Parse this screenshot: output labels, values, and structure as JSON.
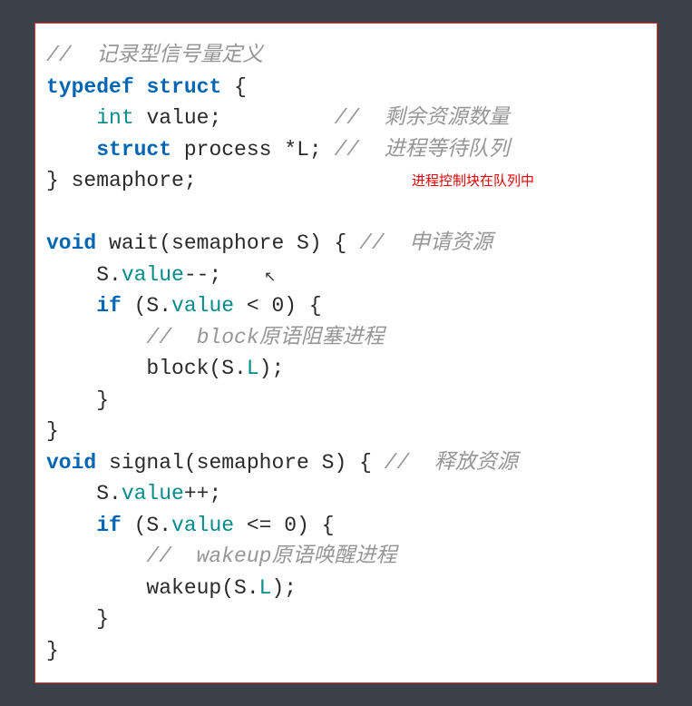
{
  "code": {
    "line1_comment": "//  记录型信号量定义",
    "line2_typedef": "typedef",
    "line2_struct": "struct",
    "line2_brace": " {",
    "line3_indent": "    ",
    "line3_type": "int",
    "line3_var": " value;         ",
    "line3_comment": "//  剩余资源数量",
    "line4_indent": "    ",
    "line4_struct": "struct",
    "line4_var": " process *L; ",
    "line4_comment": "//  进程等待队列",
    "line5": "} semaphore;",
    "line6": "",
    "line7_void": "void",
    "line7_func": " wait(semaphore S) { ",
    "line7_comment": "//  申请资源",
    "line8_indent": "    S.",
    "line8_member": "value",
    "line8_op": "--;",
    "line9_indent": "    ",
    "line9_if": "if",
    "line9_cond1": " (S.",
    "line9_member": "value",
    "line9_cond2": " < ",
    "line9_num": "0",
    "line9_cond3": ") {",
    "line10_indent": "        ",
    "line10_comment": "//  block原语阻塞进程",
    "line11_indent": "        block(S.",
    "line11_member": "L",
    "line11_end": ");",
    "line12": "    }",
    "line13": "}",
    "line14_void": "void",
    "line14_func": " signal(semaphore S) { ",
    "line14_comment": "//  释放资源",
    "line15_indent": "    S.",
    "line15_member": "value",
    "line15_op": "++;",
    "line16_indent": "    ",
    "line16_if": "if",
    "line16_cond1": " (S.",
    "line16_member": "value",
    "line16_cond2": " <= ",
    "line16_num": "0",
    "line16_cond3": ") {",
    "line17_indent": "        ",
    "line17_comment": "//  wakeup原语唤醒进程",
    "line18_indent": "        wakeup(S.",
    "line18_member": "L",
    "line18_end": ");",
    "line19": "    }",
    "line20": "}"
  },
  "annotation": "进程控制块在队列中",
  "cursor_glyph": "⤡"
}
